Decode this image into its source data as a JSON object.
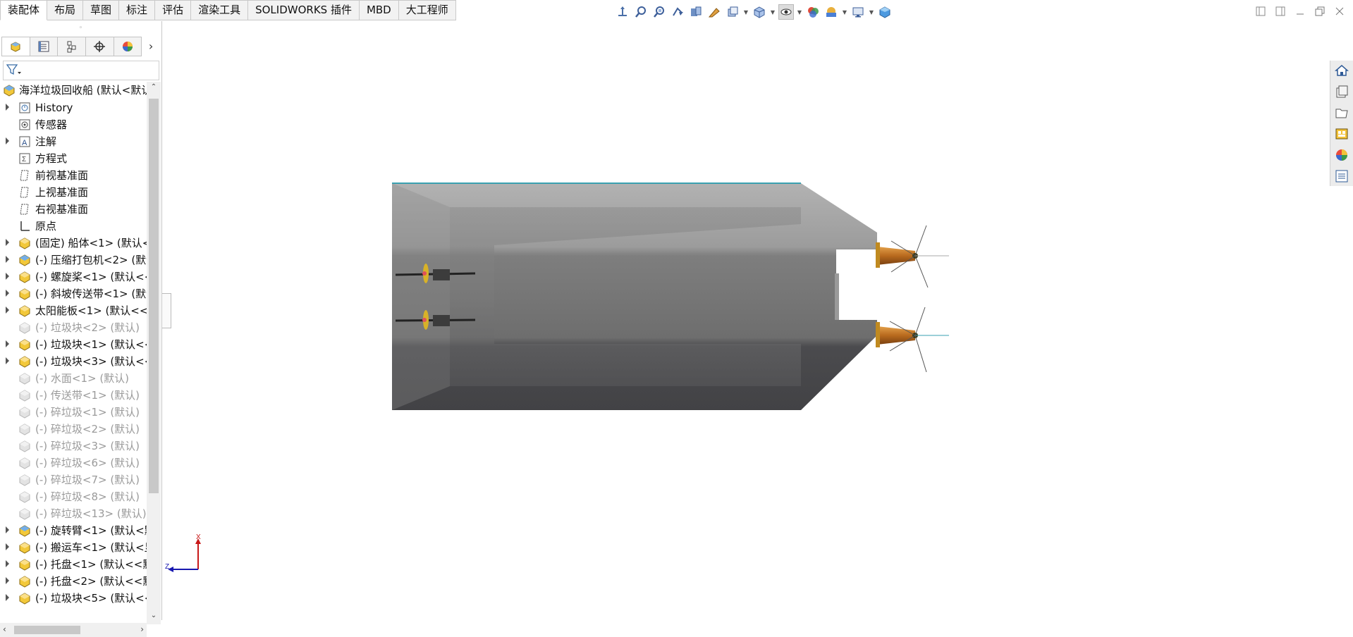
{
  "tabs": [
    "装配体",
    "布局",
    "草图",
    "标注",
    "评估",
    "渲染工具",
    "SOLIDWORKS 插件",
    "MBD",
    "大工程师"
  ],
  "active_tab": "装配体",
  "hud_icons": [
    "view-orientation-icon",
    "zoom-to-fit-icon",
    "zoom-to-area-icon",
    "previous-view-icon",
    "section-view-icon",
    "dynamic-annotation-icon",
    "view-type-icon",
    "display-style-icon",
    "hide-show-icon",
    "edit-appearance-icon",
    "apply-scene-icon",
    "view-settings-icon",
    "view-cube-icon"
  ],
  "panel_tabs": [
    "featuremanager-icon",
    "propertymanager-icon",
    "configurationmanager-icon",
    "dimxpert-icon",
    "displaymanager-icon"
  ],
  "tree": {
    "root": "海洋垃圾回收船  (默认<默认",
    "items": [
      {
        "label": "History",
        "icon": "history-icon",
        "expandable": true,
        "suppressed": false
      },
      {
        "label": "传感器",
        "icon": "sensor-icon",
        "expandable": false,
        "suppressed": false
      },
      {
        "label": "注解",
        "icon": "annotation-icon",
        "expandable": true,
        "suppressed": false
      },
      {
        "label": "方程式",
        "icon": "equation-icon",
        "expandable": false,
        "suppressed": false
      },
      {
        "label": "前视基准面",
        "icon": "plane-icon",
        "expandable": false,
        "suppressed": false
      },
      {
        "label": "上视基准面",
        "icon": "plane-icon",
        "expandable": false,
        "suppressed": false
      },
      {
        "label": "右视基准面",
        "icon": "plane-icon",
        "expandable": false,
        "suppressed": false
      },
      {
        "label": "原点",
        "icon": "origin-icon",
        "expandable": false,
        "suppressed": false
      },
      {
        "label": "(固定) 船体<1> (默认<<",
        "icon": "part-icon",
        "expandable": true,
        "suppressed": false
      },
      {
        "label": "(-) 压缩打包机<2> (默认",
        "icon": "subassembly-icon",
        "expandable": true,
        "suppressed": false
      },
      {
        "label": "(-) 螺旋桨<1> (默认<<",
        "icon": "part-icon",
        "expandable": true,
        "suppressed": false
      },
      {
        "label": "(-) 斜坡传送带<1> (默认",
        "icon": "part-icon",
        "expandable": true,
        "suppressed": false
      },
      {
        "label": "太阳能板<1> (默认<<默",
        "icon": "part-icon",
        "expandable": true,
        "suppressed": false
      },
      {
        "label": "(-) 垃圾块<2> (默认)",
        "icon": "part-icon",
        "expandable": false,
        "suppressed": true
      },
      {
        "label": "(-) 垃圾块<1> (默认<<",
        "icon": "part-icon",
        "expandable": true,
        "suppressed": false
      },
      {
        "label": "(-) 垃圾块<3> (默认<<",
        "icon": "part-icon",
        "expandable": true,
        "suppressed": false
      },
      {
        "label": "(-) 水面<1> (默认)",
        "icon": "part-icon",
        "expandable": false,
        "suppressed": true
      },
      {
        "label": "(-) 传送带<1> (默认)",
        "icon": "part-icon",
        "expandable": false,
        "suppressed": true
      },
      {
        "label": "(-) 碎垃圾<1> (默认)",
        "icon": "part-icon",
        "expandable": false,
        "suppressed": true
      },
      {
        "label": "(-) 碎垃圾<2> (默认)",
        "icon": "part-icon",
        "expandable": false,
        "suppressed": true
      },
      {
        "label": "(-) 碎垃圾<3> (默认)",
        "icon": "part-icon",
        "expandable": false,
        "suppressed": true
      },
      {
        "label": "(-) 碎垃圾<6> (默认)",
        "icon": "part-icon",
        "expandable": false,
        "suppressed": true
      },
      {
        "label": "(-) 碎垃圾<7> (默认)",
        "icon": "part-icon",
        "expandable": false,
        "suppressed": true
      },
      {
        "label": "(-) 碎垃圾<8> (默认)",
        "icon": "part-icon",
        "expandable": false,
        "suppressed": true
      },
      {
        "label": "(-) 碎垃圾<13> (默认)",
        "icon": "part-icon",
        "expandable": false,
        "suppressed": true
      },
      {
        "label": "(-) 旋转臂<1> (默认<默",
        "icon": "subassembly-icon",
        "expandable": true,
        "suppressed": false
      },
      {
        "label": "(-) 搬运车<1> (默认<显",
        "icon": "part-icon",
        "expandable": true,
        "suppressed": false
      },
      {
        "label": "(-) 托盘<1> (默认<<默",
        "icon": "part-icon",
        "expandable": true,
        "suppressed": false
      },
      {
        "label": "(-) 托盘<2> (默认<<默",
        "icon": "part-icon",
        "expandable": true,
        "suppressed": false
      },
      {
        "label": "(-) 垃圾块<5> (默认<<",
        "icon": "part-icon",
        "expandable": true,
        "suppressed": false
      }
    ]
  },
  "taskpane_icons": [
    "solidworks-resources-icon",
    "design-library-icon",
    "file-explorer-icon",
    "view-palette-icon",
    "appearances-icon",
    "custom-properties-icon"
  ],
  "triad": {
    "x_label": "X",
    "z_label": "Z"
  },
  "colors": {
    "accent": "#1f5fd0",
    "hull_top": "#a6a6a6",
    "hull_mid": "#7b7b7b",
    "hull_bottom": "#454548",
    "propeller": "#c87a28"
  }
}
